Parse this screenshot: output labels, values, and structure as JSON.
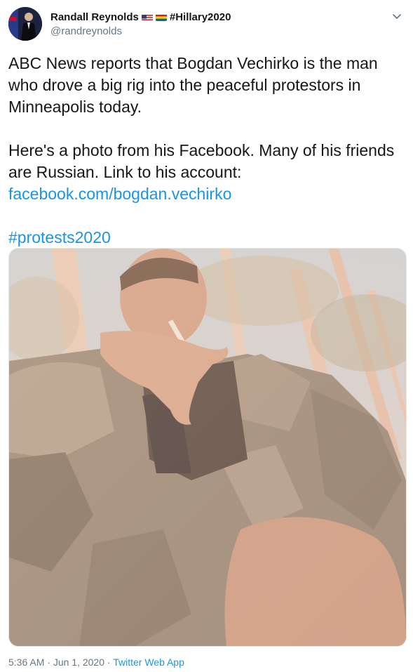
{
  "user": {
    "display_name": "Randall Reynolds",
    "handle": "@randreynolds",
    "name_hashtag": "#Hillary2020",
    "name_emojis": [
      "us-flag-icon",
      "rainbow-flag-icon"
    ]
  },
  "tweet": {
    "paragraph_1": "ABC News reports that Bogdan Vechirko is the man who drove a big rig into the peaceful protestors in Minneapolis today.",
    "paragraph_2": "Here's a photo from his Facebook. Many of his friends are Russian. Link to his account:",
    "link": "facebook.com/bogdan.vechirko",
    "hashtag": "#protests2020"
  },
  "footer": {
    "time": "5:36 AM",
    "sep1": " · ",
    "date": "Jun 1, 2020",
    "sep2": " · ",
    "source": "Twitter Web App"
  },
  "colors": {
    "text": "#14171a",
    "secondary": "#657786",
    "link": "#1b95e0"
  },
  "icons": {
    "menu": "chevron-down-icon"
  }
}
